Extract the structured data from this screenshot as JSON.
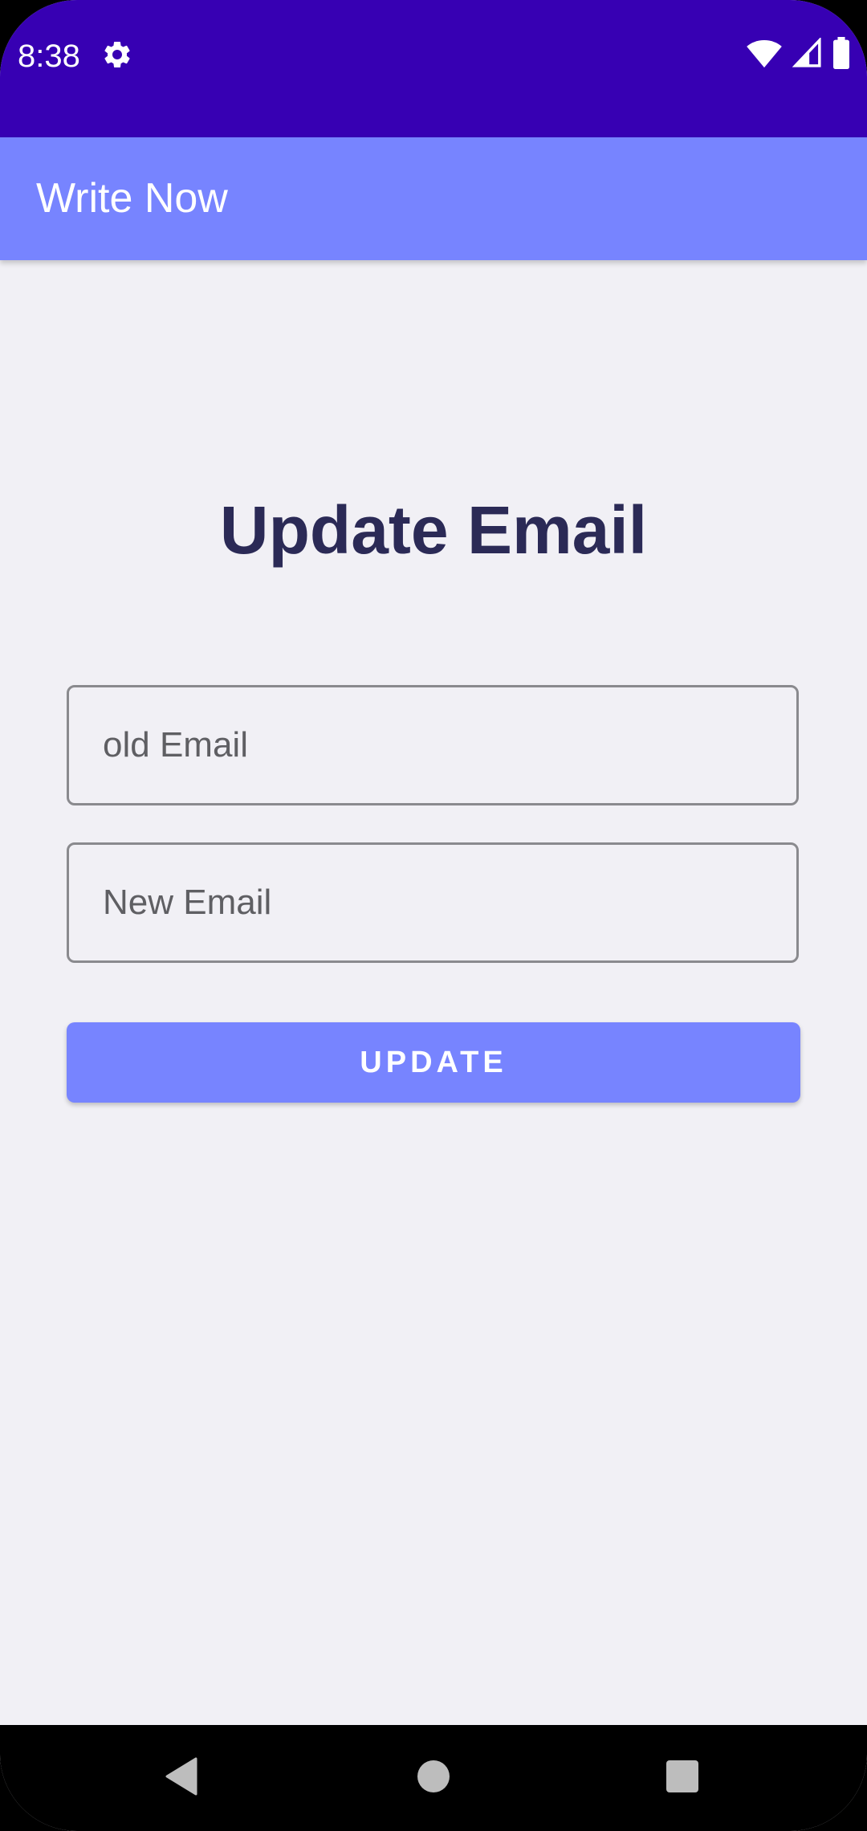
{
  "status_bar": {
    "time": "8:38",
    "icons": [
      "settings-gear-icon",
      "wifi-icon",
      "cell-signal-icon",
      "battery-icon"
    ]
  },
  "app_bar": {
    "title": "Write Now"
  },
  "form": {
    "title": "Update Email",
    "old_email": {
      "value": "",
      "placeholder": "old Email"
    },
    "new_email": {
      "value": "",
      "placeholder": "New Email"
    },
    "update_label": "UPDATE"
  },
  "nav_bar": {
    "icons": [
      "back-icon",
      "home-icon",
      "recents-icon"
    ]
  },
  "colors": {
    "status_bar": "#3700B3",
    "app_bar": "#7784FF",
    "background": "#F1F0F5",
    "title_text": "#2B2A56",
    "button": "#7784FF"
  }
}
